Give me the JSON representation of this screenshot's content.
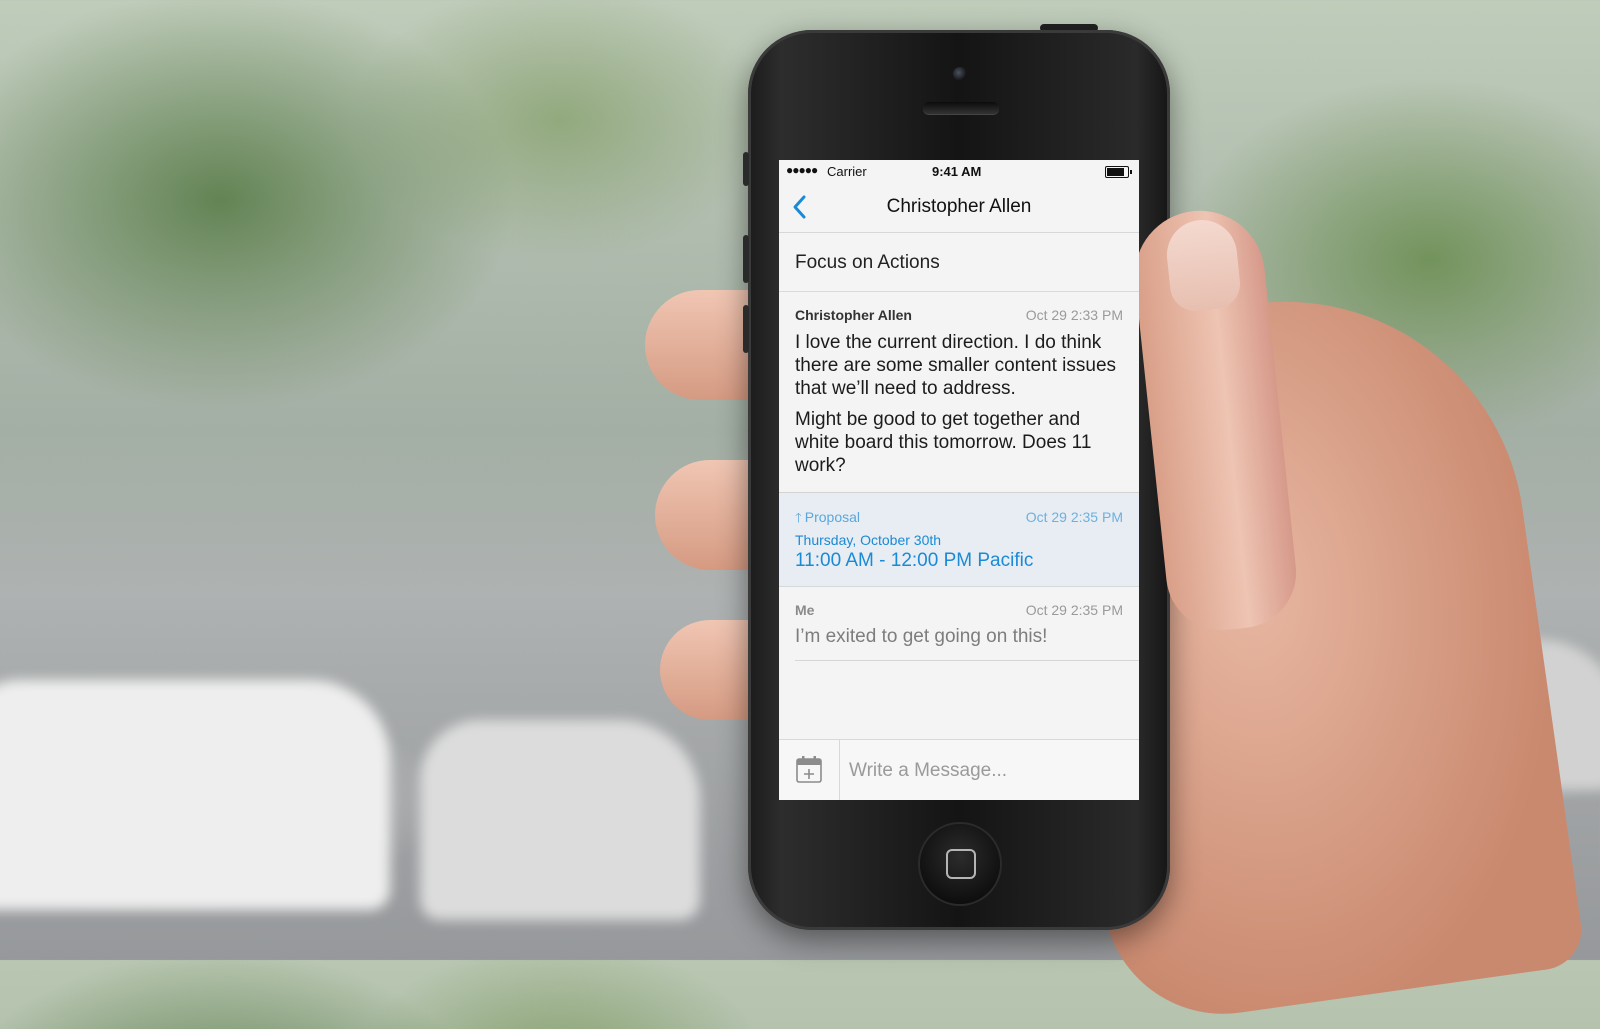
{
  "status_bar": {
    "signal": "●●●●●",
    "carrier": "Carrier",
    "time": "9:41 AM",
    "battery_level": 0.85
  },
  "nav": {
    "back_icon": "chevron-left-icon",
    "title": "Christopher Allen"
  },
  "thread": {
    "subject": "Focus on Actions"
  },
  "messages": [
    {
      "sender": "Christopher Allen",
      "timestamp": "Oct 29 2:33 PM",
      "paragraphs": [
        "I love the current direction. I do think there are some smaller content issues that we’ll need to address.",
        "Might be good to get together and white board this tomorrow. Does 11 work?"
      ]
    },
    {
      "sender": "Me",
      "timestamp": "Oct 29 2:35 PM",
      "paragraphs": [
        "I’m exited to get going on this!"
      ]
    }
  ],
  "proposal": {
    "icon": "arrow-up-icon",
    "label": "Proposal",
    "timestamp": "Oct 29 2:35 PM",
    "day": "Thursday, October 30th",
    "time_range": "11:00 AM - 12:00 PM Pacific"
  },
  "composer": {
    "calendar_icon": "calendar-add-icon",
    "placeholder": "Write a Message..."
  },
  "colors": {
    "accent": "#1b8ad6",
    "proposal_bg": "#e7edf2",
    "screen_bg": "#f4f4f4"
  }
}
